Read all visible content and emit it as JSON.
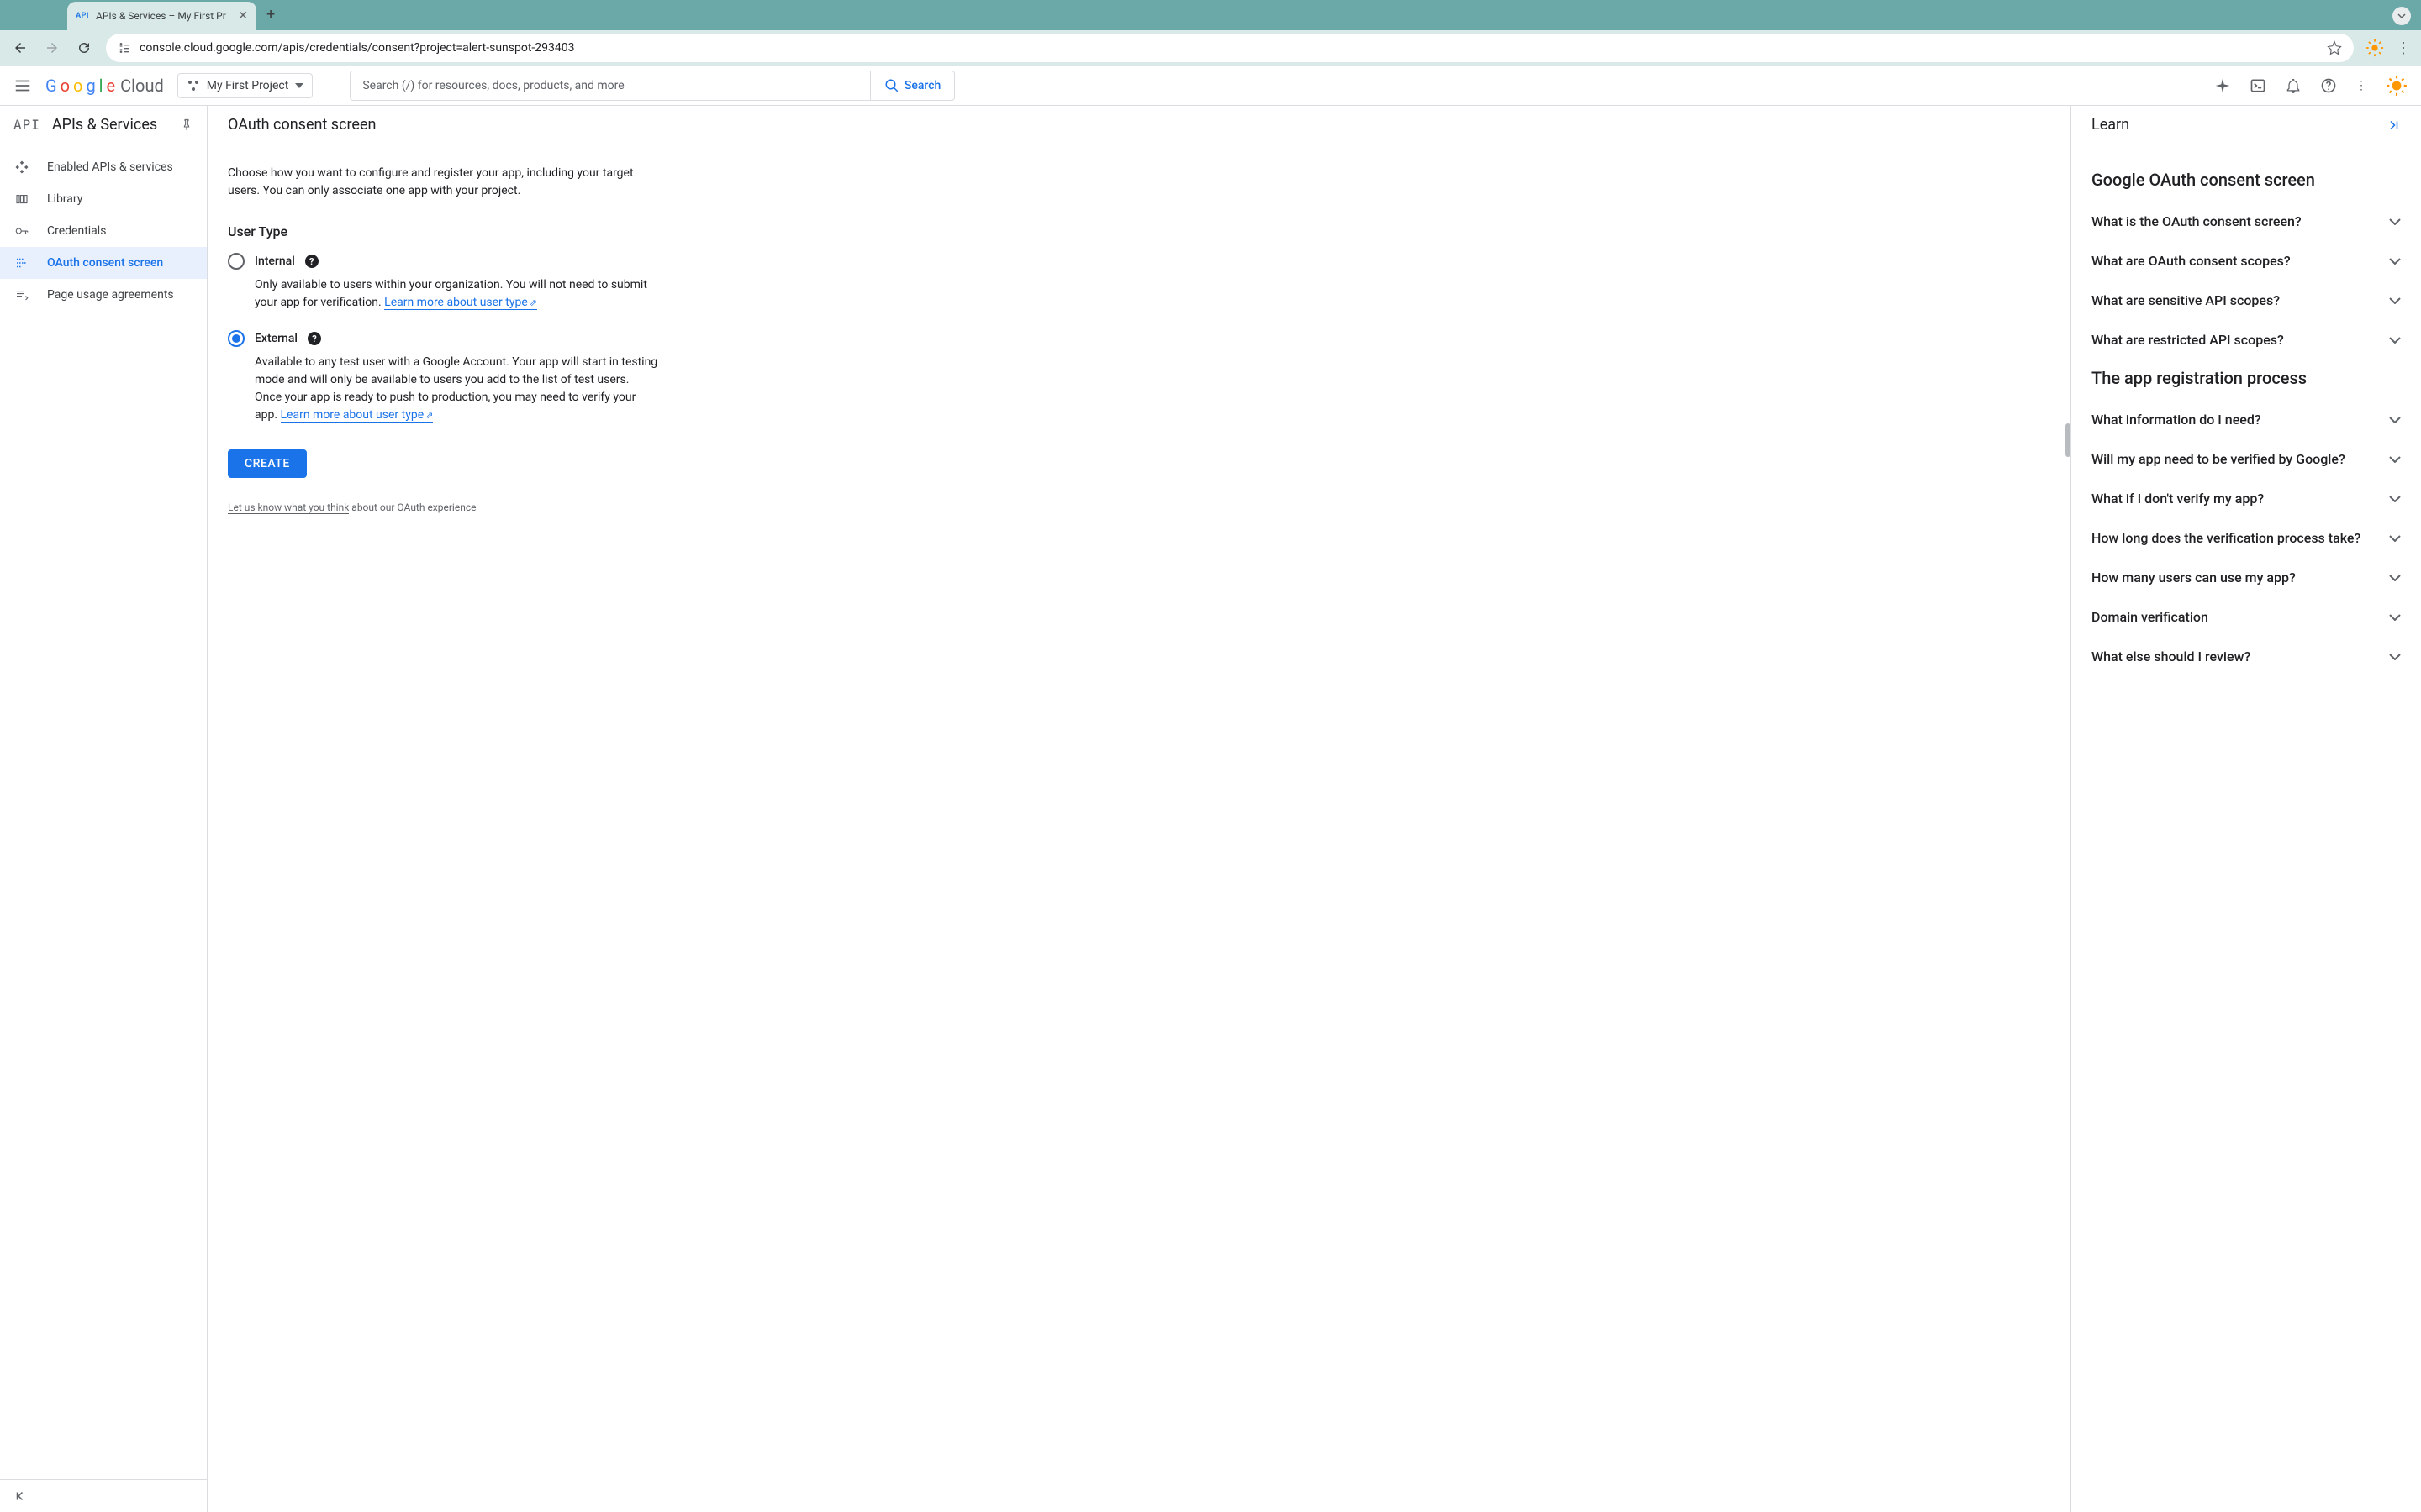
{
  "browser": {
    "tab_title": "APIs & Services – My First Pr",
    "tab_favicon_text": "API",
    "url": "console.cloud.google.com/apis/credentials/consent?project=alert-sunspot-293403"
  },
  "header": {
    "logo_text_cloud": "Cloud",
    "project_name": "My First Project",
    "search_placeholder": "Search (/) for resources, docs, products, and more",
    "search_button": "Search"
  },
  "sidebar": {
    "badge": "API",
    "title": "APIs & Services",
    "items": [
      {
        "label": "Enabled APIs & services"
      },
      {
        "label": "Library"
      },
      {
        "label": "Credentials"
      },
      {
        "label": "OAuth consent screen"
      },
      {
        "label": "Page usage agreements"
      }
    ]
  },
  "content": {
    "title": "OAuth consent screen",
    "intro": "Choose how you want to configure and register your app, including your target users. You can only associate one app with your project.",
    "user_type_heading": "User Type",
    "internal": {
      "label": "Internal",
      "desc": "Only available to users within your organization. You will not need to submit your app for verification. ",
      "link": "Learn more about user type"
    },
    "external": {
      "label": "External",
      "desc": "Available to any test user with a Google Account. Your app will start in testing mode and will only be available to users you add to the list of test users. Once your app is ready to push to production, you may need to verify your app. ",
      "link": "Learn more about user type"
    },
    "create_button": "CREATE",
    "feedback_link": "Let us know what you think",
    "feedback_suffix": " about our OAuth experience"
  },
  "learn": {
    "title": "Learn",
    "section1": "Google OAuth consent screen",
    "items1": [
      "What is the OAuth consent screen?",
      "What are OAuth consent scopes?",
      "What are sensitive API scopes?",
      "What are restricted API scopes?"
    ],
    "section2": "The app registration process",
    "items2": [
      "What information do I need?",
      "Will my app need to be verified by Google?",
      "What if I don't verify my app?",
      "How long does the verification process take?",
      "How many users can use my app?",
      "Domain verification",
      "What else should I review?"
    ]
  }
}
